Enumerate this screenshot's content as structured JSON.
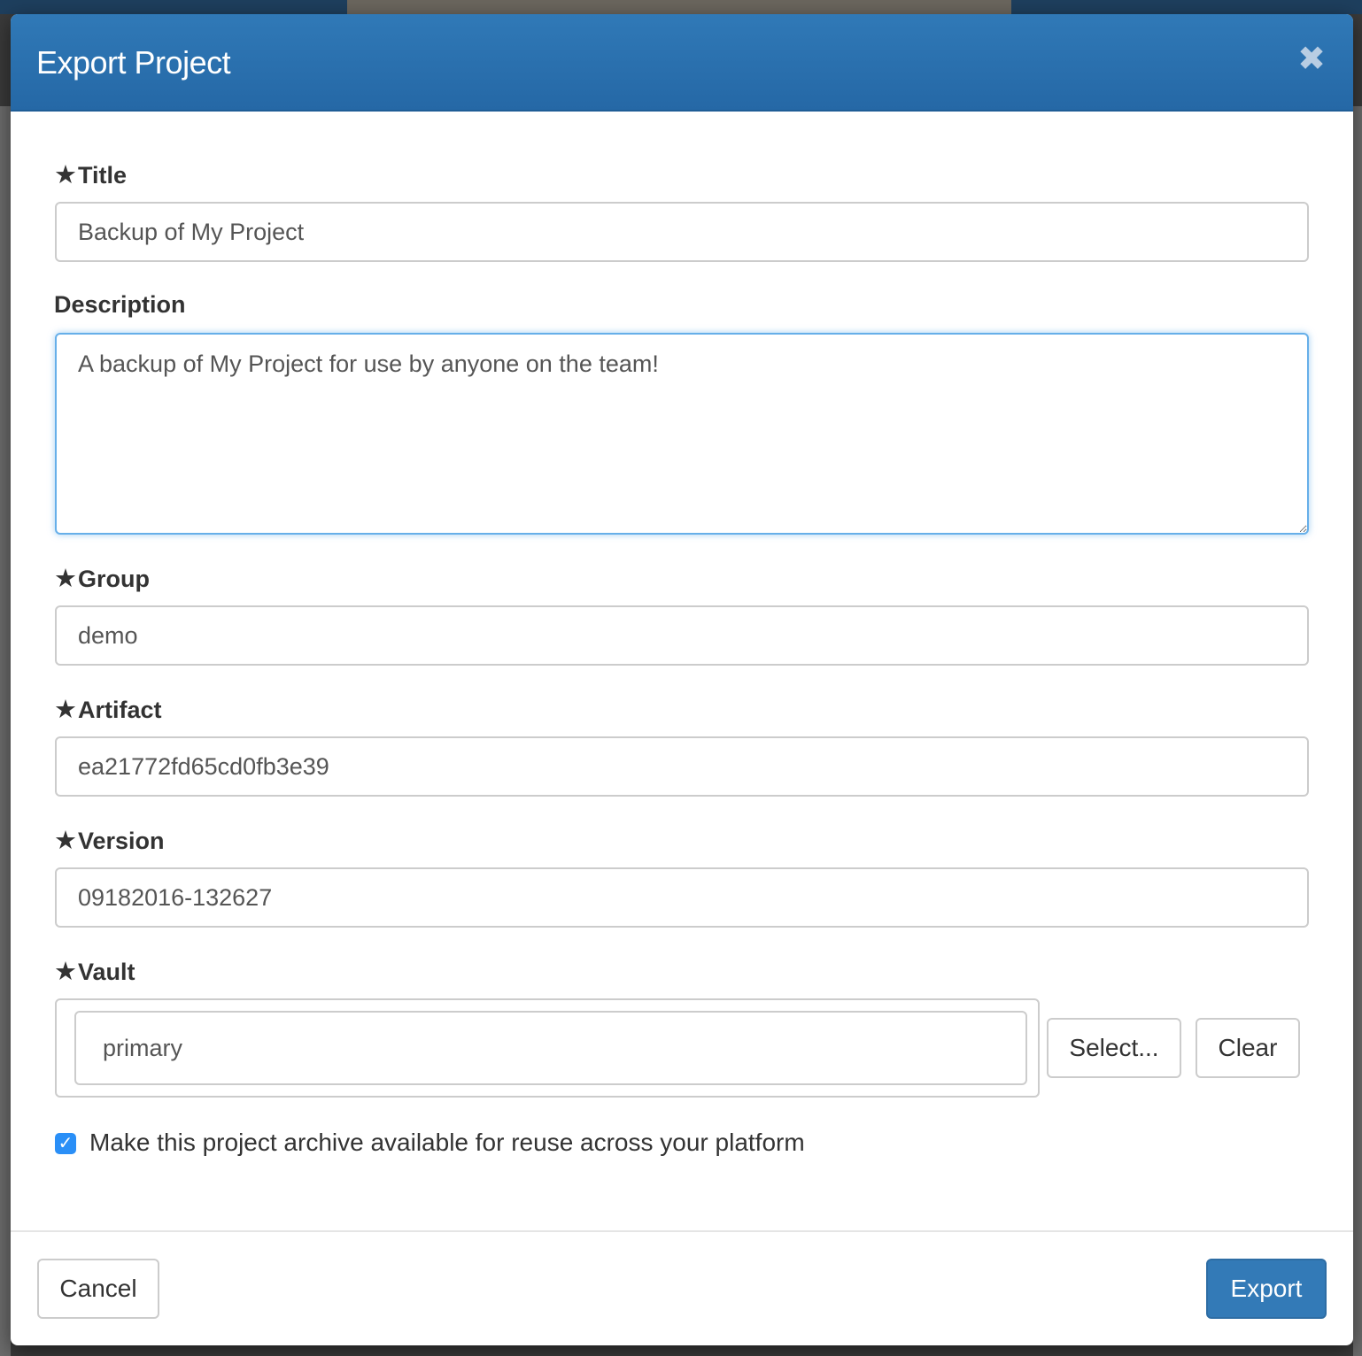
{
  "modal": {
    "title": "Export Project",
    "close_glyph": "✖"
  },
  "form": {
    "required_glyph": "★",
    "title": {
      "label": "Title",
      "value": "Backup of My Project"
    },
    "description": {
      "label": "Description",
      "value": "A backup of My Project for use by anyone on the team!"
    },
    "group": {
      "label": "Group",
      "value": "demo"
    },
    "artifact": {
      "label": "Artifact",
      "value": "ea21772fd65cd0fb3e39"
    },
    "version": {
      "label": "Version",
      "value": "09182016-132627"
    },
    "vault": {
      "label": "Vault",
      "value": "primary",
      "select_label": "Select...",
      "clear_label": "Clear"
    },
    "reuse": {
      "label": "Make this project archive available for reuse across your platform",
      "checked": true
    }
  },
  "footer": {
    "cancel_label": "Cancel",
    "export_label": "Export"
  },
  "colors": {
    "header": "#2a6faf",
    "primary": "#337ab7",
    "focus": "#66afe9"
  }
}
